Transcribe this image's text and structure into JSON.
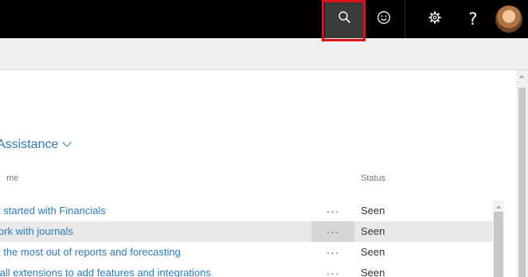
{
  "topbar": {
    "help_label": "?",
    "icons": [
      "search-icon",
      "smiley-icon",
      "gear-icon",
      "help-icon",
      "avatar"
    ]
  },
  "section": {
    "title": "Assistance",
    "icon": "chevron-down-icon"
  },
  "table": {
    "columns": {
      "name": "me",
      "status": "Status"
    },
    "more_label": "···",
    "rows": [
      {
        "name": "t started with Financials",
        "status": "Seen"
      },
      {
        "name": "ork with journals",
        "status": "Seen"
      },
      {
        "name": "t the most out of reports and forecasting",
        "status": "Seen"
      },
      {
        "name": "tall extensions to add features and integrations",
        "status": "Seen"
      }
    ]
  },
  "colors": {
    "topbar_bg": "#000000",
    "link_blue": "#2b7bc0",
    "highlight_red": "#e0101a",
    "selected_row": "#e9e9e9"
  }
}
